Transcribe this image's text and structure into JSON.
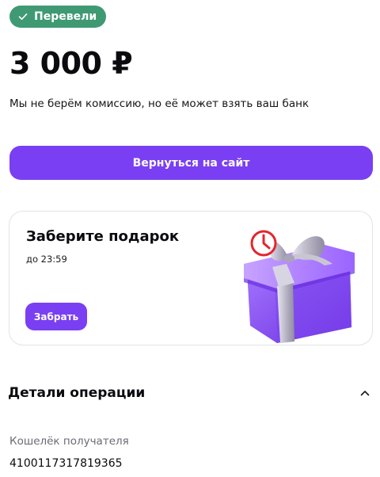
{
  "status": {
    "label": "Перевели",
    "color": "#3f9a73",
    "icon": "check-icon"
  },
  "payment": {
    "amount": "3 000 ₽",
    "fee_note": "Мы не берём комиссию, но её может взять ваш банк"
  },
  "actions": {
    "return_label": "Вернуться на сайт",
    "accent": "#7a3ff2"
  },
  "gift": {
    "title": "Заберите подарок",
    "deadline": "до 23:59",
    "take_label": "Забрать",
    "illustration": "gift-box-with-clock"
  },
  "details": {
    "title": "Детали операции",
    "expanded": true,
    "toggle_icon": "chevron-up-icon",
    "fields": [
      {
        "label": "Кошелёк получателя",
        "value": "4100117317819365"
      }
    ]
  }
}
